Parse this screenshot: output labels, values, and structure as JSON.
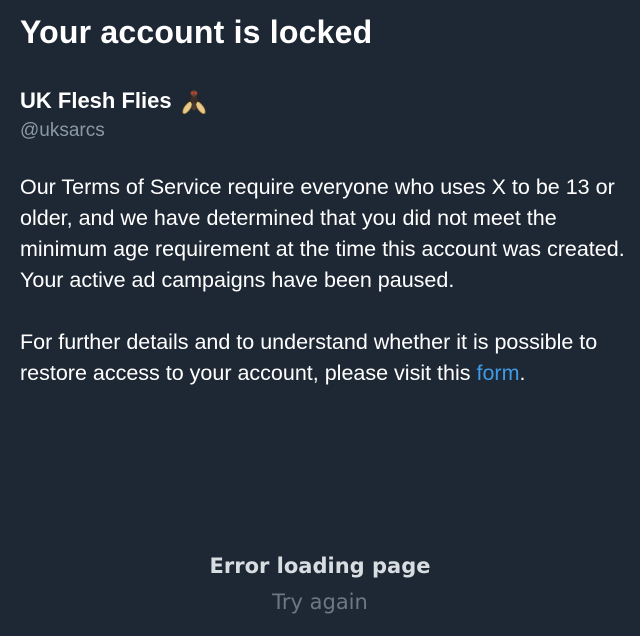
{
  "header": {
    "title": "Your account is locked"
  },
  "profile": {
    "display_name": "UK Flesh Flies",
    "emoji_icon": "fly-icon",
    "handle": "@uksarcs"
  },
  "message": {
    "paragraph1": "Our Terms of Service require everyone who uses X to be 13 or older, and we have determined that you did not meet the minimum age requirement at the time this account was created.",
    "paragraph2": "Your active ad campaigns have been paused.",
    "paragraph3_prefix": "For further details and to understand whether it is possible to restore access to your account, please visit this ",
    "link_text": "form",
    "paragraph3_suffix": "."
  },
  "error": {
    "title": "Error loading page",
    "retry_label": "Try again"
  },
  "colors": {
    "background": "#1e2834",
    "text": "#ffffff",
    "secondary_text": "#8b98a5",
    "link": "#3f9ae4",
    "muted": "#6c7885"
  }
}
